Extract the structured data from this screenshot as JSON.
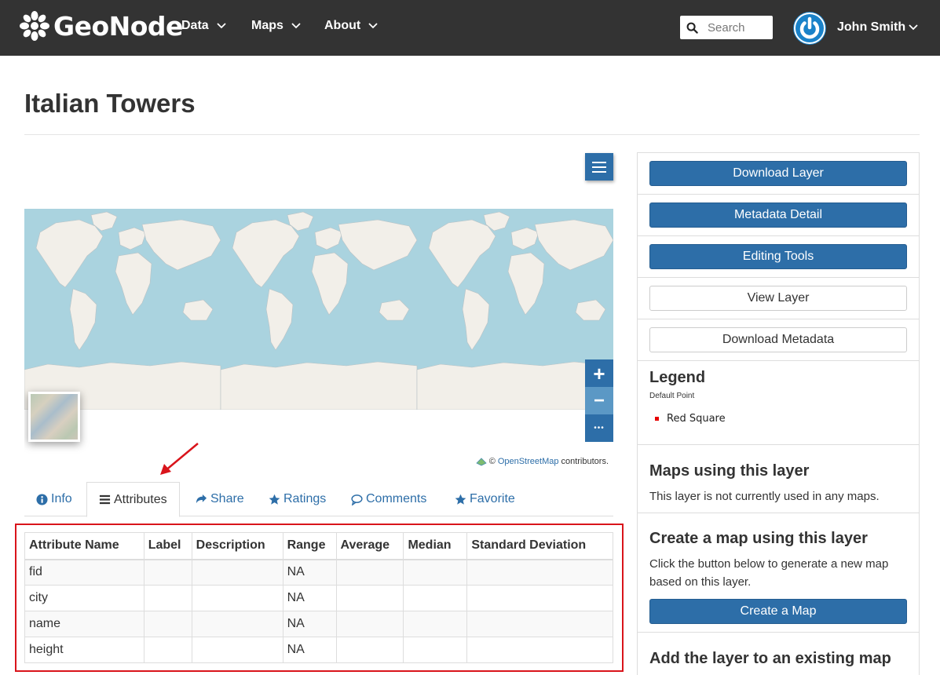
{
  "navbar": {
    "brand": "GeoNode",
    "menu": [
      {
        "label": "Data"
      },
      {
        "label": "Maps"
      },
      {
        "label": "About"
      }
    ],
    "search_placeholder": "Search",
    "user_name": "John Smith"
  },
  "page": {
    "title": "Italian Towers"
  },
  "map": {
    "zoom_in": "+",
    "zoom_out": "−",
    "more": "•••",
    "attribution_prefix": "©",
    "attribution_link": "OpenStreetMap",
    "attribution_suffix": "contributors."
  },
  "tabs": [
    {
      "label": "Info",
      "icon": "info-circle-icon",
      "active": false
    },
    {
      "label": "Attributes",
      "icon": "list-icon",
      "active": true
    },
    {
      "label": "Share",
      "icon": "share-icon",
      "active": false
    },
    {
      "label": "Ratings",
      "icon": "star-icon",
      "active": false
    },
    {
      "label": "Comments",
      "icon": "comment-icon",
      "active": false
    },
    {
      "label": "Favorite",
      "icon": "star-icon",
      "active": false
    }
  ],
  "attributes": {
    "headers": [
      "Attribute Name",
      "Label",
      "Description",
      "Range",
      "Average",
      "Median",
      "Standard Deviation"
    ],
    "rows": [
      [
        "fid",
        "",
        "",
        "NA",
        "",
        "",
        ""
      ],
      [
        "city",
        "",
        "",
        "NA",
        "",
        "",
        ""
      ],
      [
        "name",
        "",
        "",
        "NA",
        "",
        "",
        ""
      ],
      [
        "height",
        "",
        "",
        "NA",
        "",
        "",
        ""
      ]
    ]
  },
  "sidebar": {
    "buttons": {
      "download_layer": "Download Layer",
      "metadata_detail": "Metadata Detail",
      "editing_tools": "Editing Tools",
      "view_layer": "View Layer",
      "download_metadata": "Download Metadata"
    },
    "legend": {
      "title": "Legend",
      "subtitle": "Default Point",
      "item": "Red Square",
      "item_color": "#e60000"
    },
    "maps_using": {
      "title": "Maps using this layer",
      "text": "This layer is not currently used in any maps."
    },
    "create_map": {
      "title": "Create a map using this layer",
      "text": "Click the button below to generate a new map based on this layer.",
      "button": "Create a Map"
    },
    "add_to_map": {
      "title": "Add the layer to an existing map"
    }
  },
  "colors": {
    "navbar": "#333333",
    "primary": "#2d6ea8",
    "ocean": "#aad3df",
    "land": "#f2efe9",
    "annotation": "#d9141b"
  }
}
